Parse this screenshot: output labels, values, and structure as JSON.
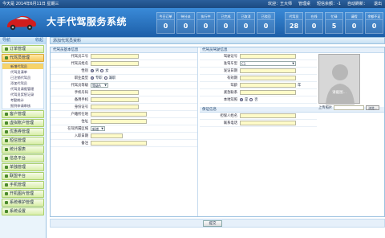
{
  "topbar": {
    "date_text": "今天是 2014年6月11日 星期三",
    "welcome": "欢迎：王大师",
    "shortcut": "管理桌",
    "sms": "短信余额：-1",
    "auto_refresh": "自动刷新：",
    "logout": "退出"
  },
  "header": {
    "title": "大手代驾服务系统",
    "stats": [
      {
        "label": "今日订单",
        "value": "0"
      },
      {
        "label": "待分派",
        "value": "0"
      },
      {
        "label": "执行中",
        "value": "0"
      },
      {
        "label": "已完成",
        "value": "0"
      },
      {
        "label": "已取消",
        "value": "0"
      },
      {
        "label": "已驳回",
        "value": "0"
      }
    ],
    "stats2": [
      {
        "label": "代驾员",
        "value": "28"
      },
      {
        "label": "在线",
        "value": "0"
      },
      {
        "label": "忙碌",
        "value": "5"
      },
      {
        "label": "请假",
        "value": "0"
      },
      {
        "label": "余额不足",
        "value": "0"
      }
    ]
  },
  "sidebar": {
    "head": "导航",
    "head_right": "收起",
    "items": [
      {
        "label": "订单管理"
      },
      {
        "label": "代驾员管理",
        "active": true,
        "sub": [
          "新增代驾员",
          "代驾员清单",
          "已注销代驾员",
          "添加代驾员",
          "代驾员请假管理",
          "代驾员奖惩记录",
          "考勤统计",
          "报到申请审核"
        ]
      },
      {
        "label": "客户管理"
      },
      {
        "label": "虚拟账户管理"
      },
      {
        "label": "优惠券管理"
      },
      {
        "label": "短信管理"
      },
      {
        "label": "统计报表"
      },
      {
        "label": "信息平台"
      },
      {
        "label": "单独管理"
      },
      {
        "label": "联盟平台"
      },
      {
        "label": "手机管理"
      },
      {
        "label": "开机图片管理"
      },
      {
        "label": "系统维护管理"
      },
      {
        "label": "系统设置"
      }
    ]
  },
  "main": {
    "crumb": "添加代驾员资料",
    "left_section": "代驾员基本信息",
    "left_fields": [
      {
        "label": "代驾员工号",
        "type": "input"
      },
      {
        "label": "代驾员姓名",
        "type": "input"
      },
      {
        "label": "性别",
        "type": "radio",
        "options": [
          "男",
          "女"
        ]
      },
      {
        "label": "职业类型",
        "type": "radio",
        "options": [
          "专职",
          "兼职"
        ]
      },
      {
        "label": "代驾员等级",
        "type": "select",
        "value": "等级A"
      },
      {
        "label": "手机号码",
        "type": "input"
      },
      {
        "label": "备用手机",
        "type": "input"
      },
      {
        "label": "身份证号",
        "type": "input"
      },
      {
        "label": "户籍所在地",
        "type": "input"
      },
      {
        "label": "住址",
        "type": "input"
      },
      {
        "label": "在驾所属区域",
        "type": "select",
        "value": "新增"
      },
      {
        "label": "入职日期",
        "type": "input"
      },
      {
        "label": "备注",
        "type": "input"
      }
    ],
    "right_section": "代驾员驾驶信息",
    "right_fields": [
      {
        "label": "驾驶证号",
        "type": "input"
      },
      {
        "label": "准驾车型",
        "type": "select",
        "value": "C1"
      },
      {
        "label": "发证日期",
        "type": "input"
      },
      {
        "label": "有效期",
        "type": "input"
      },
      {
        "label": "驾龄",
        "type": "input",
        "suffix": "年"
      },
      {
        "label": "紧急联系",
        "type": "input"
      },
      {
        "label": "本地驾照",
        "type": "radio",
        "options": [
          "是",
          "否"
        ]
      }
    ],
    "right_section2": "保证信息",
    "right_fields2": [
      {
        "label": "担保人姓名",
        "type": "input"
      },
      {
        "label": "联系电话",
        "type": "input"
      }
    ],
    "photo_label": "请截图...",
    "upload_label": "上传照片",
    "browse": "浏览...",
    "submit": "提交"
  }
}
